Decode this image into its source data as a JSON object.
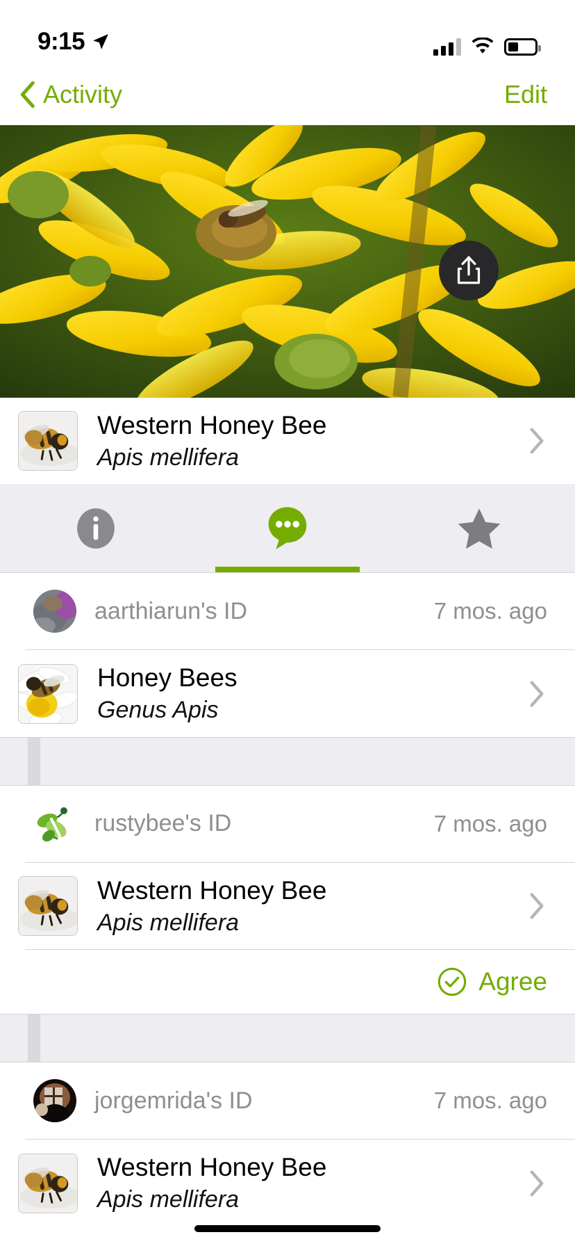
{
  "status_bar": {
    "time": "9:15",
    "location_icon": "location-arrow-icon",
    "signal_icon": "cellular-bars-icon",
    "wifi_icon": "wifi-icon",
    "battery_icon": "battery-icon",
    "battery_level_pct": 38
  },
  "nav_bar": {
    "back_icon": "chevron-left-icon",
    "back_label": "Activity",
    "edit_label": "Edit",
    "accent_color": "#74ac00"
  },
  "hero": {
    "share_icon": "share-icon",
    "alt": "yellow sunflower-like blossoms with a bee"
  },
  "observation": {
    "common_name": "Western Honey Bee",
    "scientific_name": "Apis mellifera",
    "thumbnail_icon": "honey-bee-thumbnail",
    "disclosure_icon": "chevron-right-icon"
  },
  "tabs": [
    {
      "name": "info",
      "icon": "info-circle-icon",
      "active": false
    },
    {
      "name": "comments",
      "icon": "chat-bubble-icon",
      "active": true
    },
    {
      "name": "faves",
      "icon": "star-icon",
      "active": false
    }
  ],
  "identifications": [
    {
      "user_label": "aarthiarun's ID",
      "time": "7 mos. ago",
      "avatar_icon": "user-avatar-photo",
      "avatar_kind": "photo-purple",
      "taxon": {
        "common_name": "Honey Bees",
        "scientific_name": "Genus Apis",
        "thumbnail_icon": "bee-on-daisy-thumbnail",
        "disclosure_icon": "chevron-right-icon"
      },
      "agree": null
    },
    {
      "user_label": "rustybee's ID",
      "time": "7 mos. ago",
      "avatar_icon": "rustybee-logo-icon",
      "avatar_kind": "logo-green-bee",
      "taxon": {
        "common_name": "Western Honey Bee",
        "scientific_name": "Apis mellifera",
        "thumbnail_icon": "honey-bee-thumbnail",
        "disclosure_icon": "chevron-right-icon"
      },
      "agree": {
        "label": "Agree",
        "icon": "check-circle-icon"
      }
    },
    {
      "user_label": "jorgemrida's ID",
      "time": "7 mos. ago",
      "avatar_icon": "user-avatar-photo",
      "avatar_kind": "photo-dark",
      "taxon": {
        "common_name": "Western Honey Bee",
        "scientific_name": "Apis mellifera",
        "thumbnail_icon": "honey-bee-thumbnail",
        "disclosure_icon": "chevron-right-icon"
      },
      "agree": null
    }
  ],
  "colors": {
    "accent_green": "#74ac00",
    "muted_gray": "#8e8e93",
    "panel_gray": "#eeedf1",
    "separator": "#d4d4d6"
  }
}
